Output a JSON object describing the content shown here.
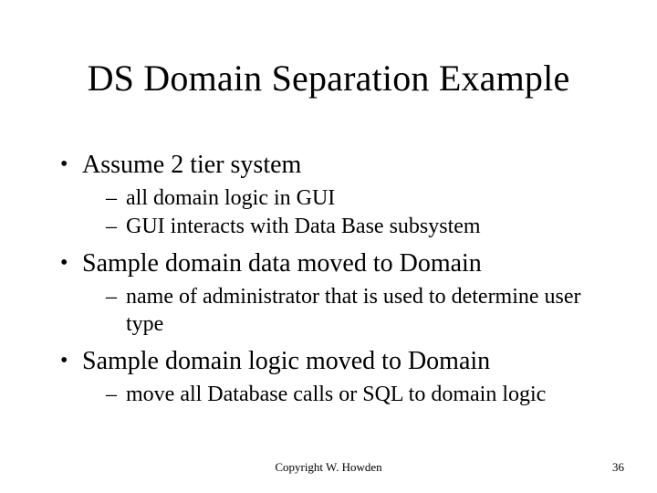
{
  "title": "DS Domain Separation Example",
  "bullets": [
    {
      "text": "Assume 2 tier system",
      "sub": [
        "all domain logic in GUI",
        "GUI interacts with Data Base subsystem"
      ]
    },
    {
      "text": "Sample domain data moved to Domain",
      "sub": [
        "name of administrator that is used to determine user type"
      ]
    },
    {
      "text": "Sample domain logic moved to Domain",
      "sub": [
        "move all Database calls or SQL to domain logic"
      ]
    }
  ],
  "footer": {
    "center": "Copyright W. Howden",
    "page": "36"
  }
}
